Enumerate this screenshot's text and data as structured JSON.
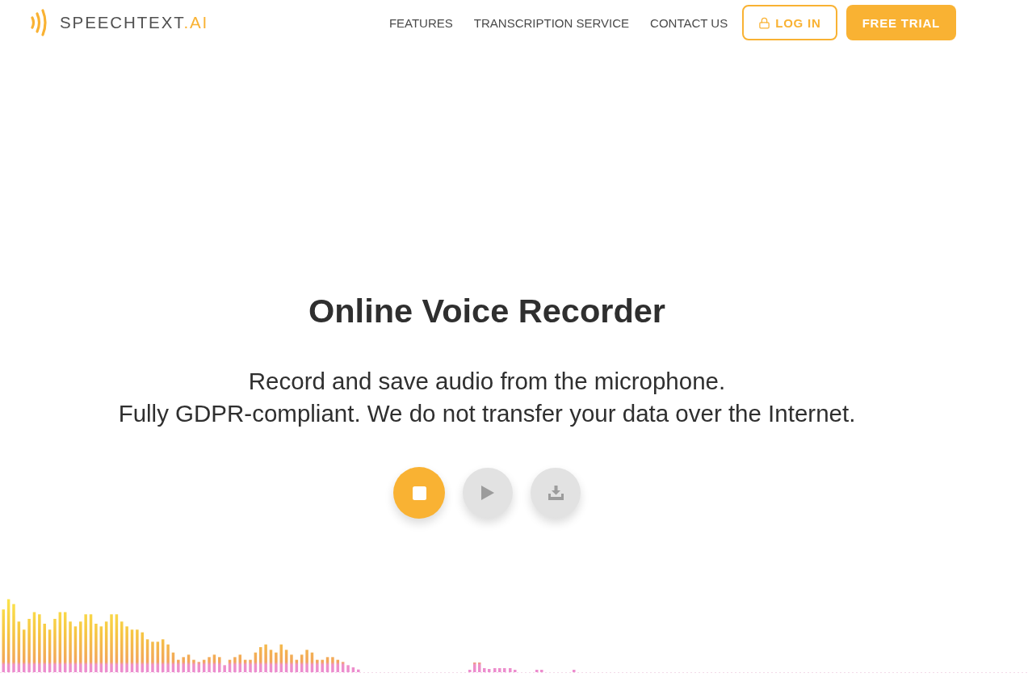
{
  "header": {
    "logo": {
      "name": "SPEECHTEXT",
      "suffix": ".AI"
    },
    "nav": [
      "FEATURES",
      "TRANSCRIPTION SERVICE",
      "CONTACT US"
    ],
    "login_button": "LOG IN",
    "trial_button": "FREE TRIAL"
  },
  "hero": {
    "title": "Online Voice Recorder",
    "subtitle_lines": [
      "Record and save audio from the microphone.",
      "Fully GDPR-compliant. We do not transfer your data over the Internet."
    ]
  },
  "controls": [
    {
      "kind": "stop",
      "disabled": false
    },
    {
      "kind": "play",
      "disabled": true
    },
    {
      "kind": "download",
      "disabled": true
    }
  ]
}
